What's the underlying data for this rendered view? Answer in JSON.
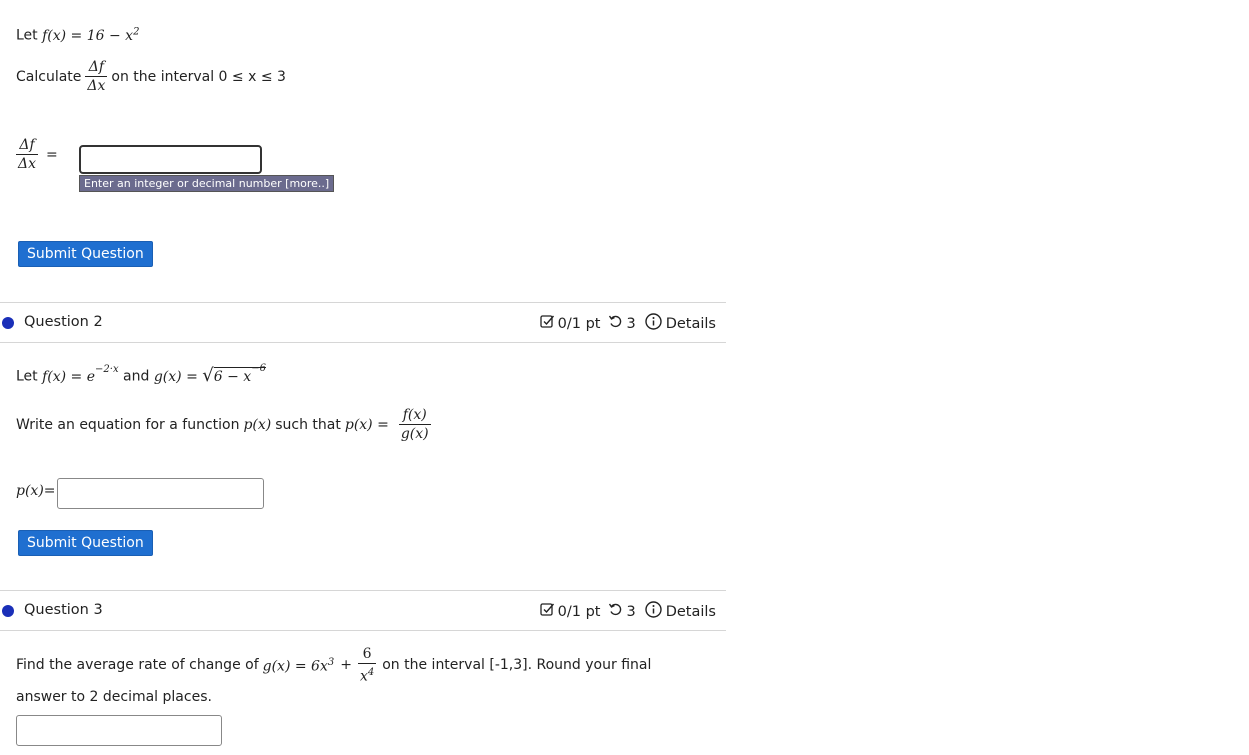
{
  "q1": {
    "let_prefix": "Let",
    "f_def": "f(x) = 16 − x",
    "f_exp": "2",
    "calc_prefix": "Calculate",
    "frac_num": "Δf",
    "frac_den": "Δx",
    "interval_text": "on the interval 0 ≤ x ≤ 3",
    "equals": "=",
    "answer_value": "",
    "hint": "Enter an integer or decimal number [more..]",
    "submit": "Submit Question"
  },
  "q2": {
    "title": "Question 2",
    "score": "0/1 pt",
    "tries": "3",
    "details": "Details",
    "let_prefix": "Let",
    "f_def": "f(x) = e",
    "f_exp": "−2·x",
    "and_text": "and",
    "g_def": "g(x) = ",
    "sqrt_body": "6 − x",
    "g_exp": "−6",
    "prompt_prefix": "Write an equation for a function",
    "p_var": "p(x)",
    "such_that": "such that",
    "p_eq": "p(x) =",
    "frac_num": "f(x)",
    "frac_den": "g(x)",
    "input_label": "p(x)=",
    "answer_value": "",
    "submit": "Submit Question"
  },
  "q3": {
    "title": "Question 3",
    "score": "0/1 pt",
    "tries": "3",
    "details": "Details",
    "prompt_prefix": "Find the average rate of change of",
    "g_def": "g(x) = 6x",
    "g_exp": "3",
    "plus": "+",
    "frac_num": "6",
    "frac_den": "x",
    "frac_den_exp": "4",
    "prompt_suffix": "on the interval [-1,3]. Round your final",
    "prompt_line2": "answer to 2 decimal places.",
    "answer_value": ""
  },
  "colors": {
    "button": "#1f6fd0",
    "dot": "#1a2fb8",
    "hint_bg": "#6b6b8e"
  },
  "icons": {
    "score": "checkbox-pen-icon",
    "retry": "retry-icon",
    "details": "info-icon"
  }
}
